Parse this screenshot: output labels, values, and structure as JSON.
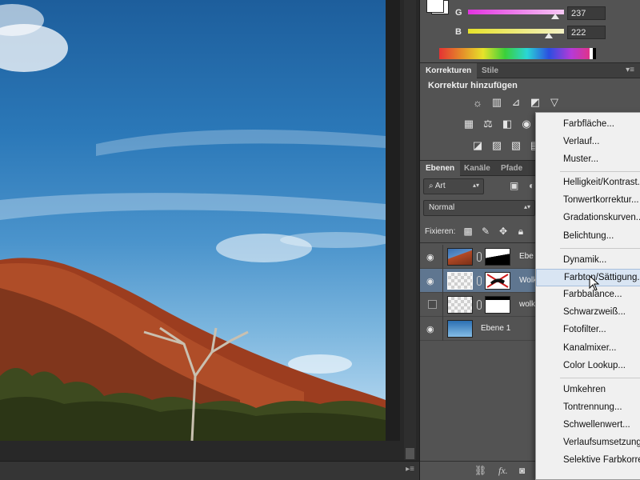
{
  "color_panel": {
    "rows": [
      {
        "channel": "G",
        "value": "237",
        "color_from": "#e233e0",
        "color_to": "#ffffff"
      },
      {
        "channel": "B",
        "value": "222",
        "color_from": "#e6e22a",
        "color_to": "#ffffff"
      }
    ]
  },
  "corrections_panel": {
    "tabs": [
      "Korrekturen",
      "Stile"
    ],
    "active_tab": "Korrekturen",
    "title": "Korrektur hinzufügen",
    "icons_row1": [
      "brightness-icon",
      "levels-icon",
      "curves-icon",
      "exposure-icon",
      "vibrance-icon"
    ],
    "icons_row2": [
      "hue-saturation-icon",
      "color-balance-icon",
      "black-white-icon",
      "photo-filter-icon"
    ],
    "icons_row3": [
      "invert-icon",
      "posterize-icon",
      "threshold-icon",
      "gradient-map-icon"
    ]
  },
  "layers_panel": {
    "tabs": [
      "Ebenen",
      "Kanäle",
      "Pfade"
    ],
    "active_tab": "Ebenen",
    "filter_label": "Art",
    "blend_mode": "Normal",
    "lock_label": "Fixieren:",
    "layers": [
      {
        "name": "Ebe",
        "visible": true,
        "selected": false
      },
      {
        "name": "Wolk",
        "visible": true,
        "selected": true
      },
      {
        "name": "wolk",
        "visible": false,
        "selected": false
      },
      {
        "name": "Ebene 1",
        "visible": true,
        "selected": false
      }
    ]
  },
  "context_menu": {
    "groups": [
      [
        "Farbfläche...",
        "Verlauf...",
        "Muster..."
      ],
      [
        "Helligkeit/Kontrast...",
        "Tonwertkorrektur...",
        "Gradationskurven...",
        "Belichtung..."
      ],
      [
        "Dynamik...",
        "Farbton/Sättigung...",
        "Farbbalance...",
        "Schwarzweiß...",
        "Fotofilter...",
        "Kanalmixer...",
        "Color Lookup..."
      ],
      [
        "Umkehren",
        "Tontrennung...",
        "Schwellenwert...",
        "Verlaufsumsetzung...",
        "Selektive Farbkorrektur..."
      ]
    ],
    "hovered_item": "Farbton/Sättigung..."
  }
}
